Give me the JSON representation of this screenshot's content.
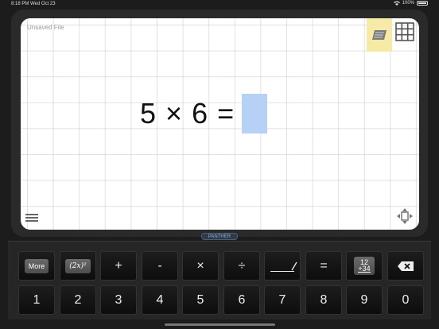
{
  "status": {
    "time": "8:18 PM",
    "date": "Wed Oct 23",
    "battery": "100%"
  },
  "document": {
    "filename": "Unsaved File"
  },
  "equation": {
    "operand1": "5",
    "operator": "×",
    "operand2": "6",
    "equals": "="
  },
  "brand": "PANTHER",
  "keyboard": {
    "row1": {
      "more": "More",
      "power": "(2x)²",
      "plus": "+",
      "minus": "-",
      "times": "×",
      "divide": "÷",
      "equals": "=",
      "column_top": "12",
      "column_bottom": "+34"
    },
    "row2": [
      "1",
      "2",
      "3",
      "4",
      "5",
      "6",
      "7",
      "8",
      "9",
      "0"
    ]
  },
  "colors": {
    "answer_box": "#b7d0f5",
    "note_button": "#f6eaa6",
    "brand_text": "#8fb3dd"
  },
  "icons": [
    "wifi-icon",
    "battery-icon",
    "note-icon",
    "grid-icon",
    "menu-icon",
    "move-icon",
    "backspace-icon"
  ]
}
